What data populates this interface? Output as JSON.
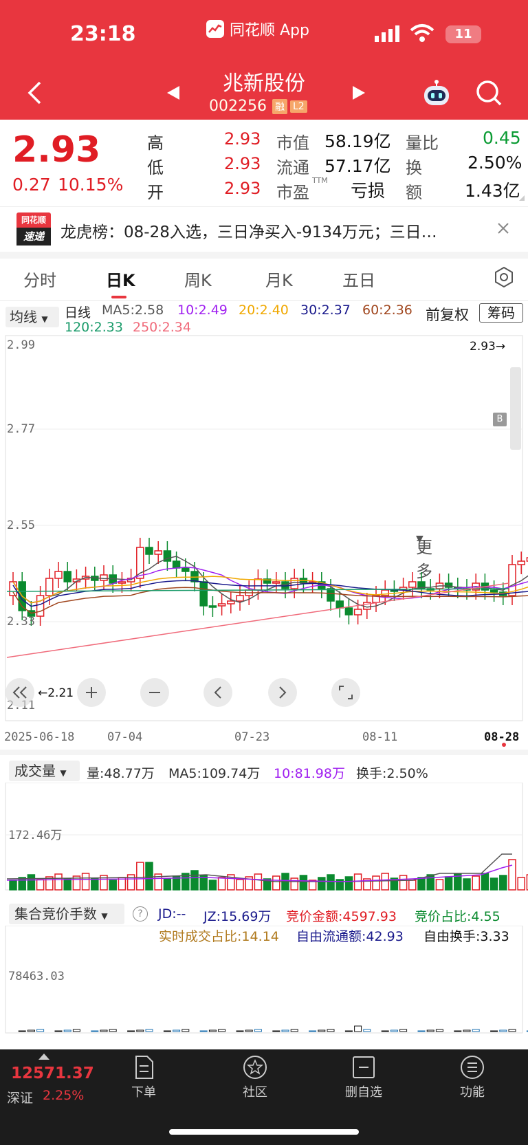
{
  "status_bar": {
    "time": "23:18",
    "app_name": "同花顺 App",
    "battery": "11"
  },
  "header": {
    "stock_name": "兆新股份",
    "stock_code": "002256",
    "badge_margin": "融",
    "badge_level": "L2"
  },
  "quote": {
    "price": "2.93",
    "change": "0.27",
    "change_pct": "10.15%",
    "high_label": "高",
    "high": "2.93",
    "low_label": "低",
    "low": "2.93",
    "open_label": "开",
    "open": "2.93",
    "mcap_label": "市值",
    "mcap": "58.19亿",
    "float_label": "流通",
    "float": "57.17亿",
    "pe_label": "市盈",
    "pe_sup": "TTM",
    "pe": "亏损",
    "vr_label": "量比",
    "vr": "0.45",
    "turnover_label": "换",
    "turnover": "2.50%",
    "amount_label": "额",
    "amount": "1.43亿"
  },
  "news": {
    "logo_top": "同花顺",
    "logo_bottom": "速递",
    "text": "龙虎榜：08-28入选，三日净买入-9134万元；三日…"
  },
  "tabs": [
    "分时",
    "日K",
    "周K",
    "月K",
    "五日",
    "更多"
  ],
  "active_tab": "日K",
  "ma_bar": {
    "selector": "均线",
    "period": "日线",
    "ma5": "MA5:2.58",
    "ma10": "10:2.49",
    "ma20": "20:2.40",
    "ma30": "30:2.37",
    "ma60": "60:2.36",
    "ma120": "120:2.33",
    "ma250": "250:2.34",
    "adjust": "前复权",
    "chip_button": "筹码"
  },
  "kline": {
    "y_ticks": [
      "2.99",
      "2.77",
      "2.55",
      "2.33",
      "2.11"
    ],
    "last_price_label": "2.93→",
    "low_marker": "←2.21",
    "buy_marker": "B",
    "x_ticks": [
      "2025-06-18",
      "07-04",
      "07-23",
      "08-11",
      "08-28"
    ]
  },
  "volume": {
    "selector": "成交量",
    "vol": "量:48.77万",
    "ma5": "MA5:109.74万",
    "ma10": "10:81.98万",
    "turnover": "换手:2.50%",
    "y_tick": "172.46万"
  },
  "auction": {
    "selector": "集合竞价手数",
    "jd": "JD:--",
    "jz": "JZ:15.69万",
    "amount": "竞价金额:4597.93",
    "ratio": "竞价占比:4.55",
    "realtime": "实时成交占比:14.14",
    "free_float": "自由流通额:42.93",
    "free_turnover": "自由换手:3.33",
    "y_tick": "78463.03"
  },
  "index": {
    "value": "12571.37",
    "name": "深证",
    "pct": "2.25%"
  },
  "bottom_nav": [
    "下单",
    "社区",
    "删自选",
    "功能"
  ],
  "colors": {
    "header_red": "#e8363f",
    "up": "#e01d24",
    "down": "#0a8a2e",
    "ma5": "#555555",
    "ma10": "#a020f0",
    "ma20": "#f0a800",
    "ma30": "#1a1a8c",
    "ma60": "#a0461e",
    "ma120": "#1a9b6a",
    "ma250": "#f06a7a"
  }
}
